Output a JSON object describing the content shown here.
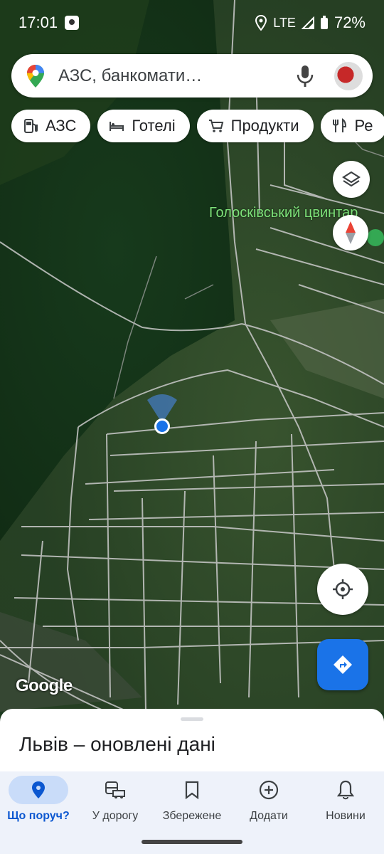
{
  "status_bar": {
    "time": "17:01",
    "network": "LTE",
    "battery": "72%"
  },
  "search": {
    "placeholder": "АЗС, банкомати…"
  },
  "chips": [
    {
      "label": "АЗС",
      "icon": "gas-station-icon"
    },
    {
      "label": "Готелі",
      "icon": "bed-icon"
    },
    {
      "label": "Продукти",
      "icon": "cart-icon"
    },
    {
      "label": "Ре",
      "icon": "restaurant-icon"
    }
  ],
  "map": {
    "place_label": "Голосківський цвинтар",
    "attribution": "Google"
  },
  "sheet": {
    "title": "Львів – оновлені дані"
  },
  "bottom_nav": [
    {
      "label": "Що поруч?",
      "icon": "location-pin-icon",
      "active": true
    },
    {
      "label": "У дорогу",
      "icon": "commute-icon",
      "active": false
    },
    {
      "label": "Збережене",
      "icon": "bookmark-icon",
      "active": false
    },
    {
      "label": "Додати",
      "icon": "add-circle-icon",
      "active": false
    },
    {
      "label": "Новини",
      "icon": "bell-icon",
      "active": false
    }
  ],
  "colors": {
    "accent": "#1a73e8",
    "active_nav": "#0b57d0",
    "nav_bg": "#eef2fa",
    "place_label": "#7ee27a"
  }
}
